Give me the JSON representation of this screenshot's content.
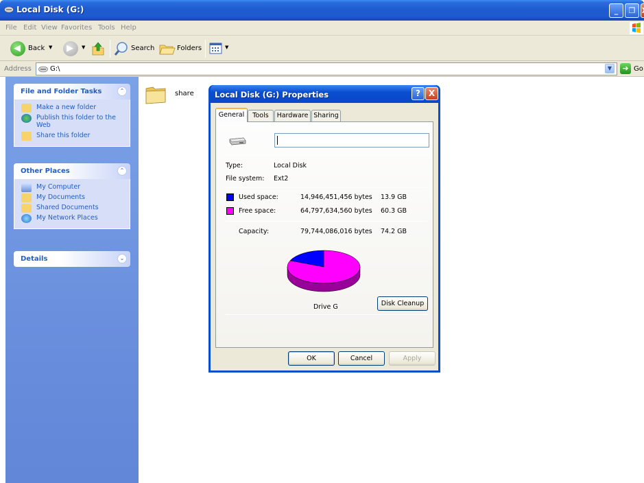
{
  "window": {
    "title": "Local Disk (G:)",
    "buttons": {
      "minimize": "_",
      "maximize": "❐",
      "close": "X"
    }
  },
  "menu": [
    "File",
    "Edit",
    "View",
    "Favorites",
    "Tools",
    "Help"
  ],
  "toolbar": {
    "back": "Back",
    "search": "Search",
    "folders": "Folders"
  },
  "address": {
    "label": "Address",
    "value": "G:\\",
    "go": "Go"
  },
  "left_pane": {
    "file_tasks": {
      "title": "File and Folder Tasks",
      "items": [
        "Make a new folder",
        "Publish this folder to the Web",
        "Share this folder"
      ]
    },
    "other_places": {
      "title": "Other Places",
      "items": [
        "My Computer",
        "My Documents",
        "Shared Documents",
        "My Network Places"
      ]
    },
    "details": {
      "title": "Details"
    }
  },
  "folder": {
    "name": "share"
  },
  "dialog": {
    "title": "Local Disk (G:) Properties",
    "help": "?",
    "close": "X",
    "tabs": [
      "General",
      "Tools",
      "Hardware",
      "Sharing"
    ],
    "name_value": "",
    "type_label": "Type:",
    "type_value": "Local Disk",
    "fs_label": "File system:",
    "fs_value": "Ext2",
    "used_label": "Used space:",
    "used_bytes": "14,946,451,456 bytes",
    "used_gb": "13.9 GB",
    "free_label": "Free space:",
    "free_bytes": "64,797,634,560 bytes",
    "free_gb": "60.3 GB",
    "capacity_label": "Capacity:",
    "capacity_bytes": "79,744,086,016 bytes",
    "capacity_gb": "74.2 GB",
    "drive_label": "Drive G",
    "disk_cleanup": "Disk Cleanup",
    "ok": "OK",
    "cancel": "Cancel",
    "apply": "Apply",
    "used_fraction": 0.1874,
    "colors": {
      "used": "#0000ff",
      "free": "#ff00ff"
    }
  }
}
